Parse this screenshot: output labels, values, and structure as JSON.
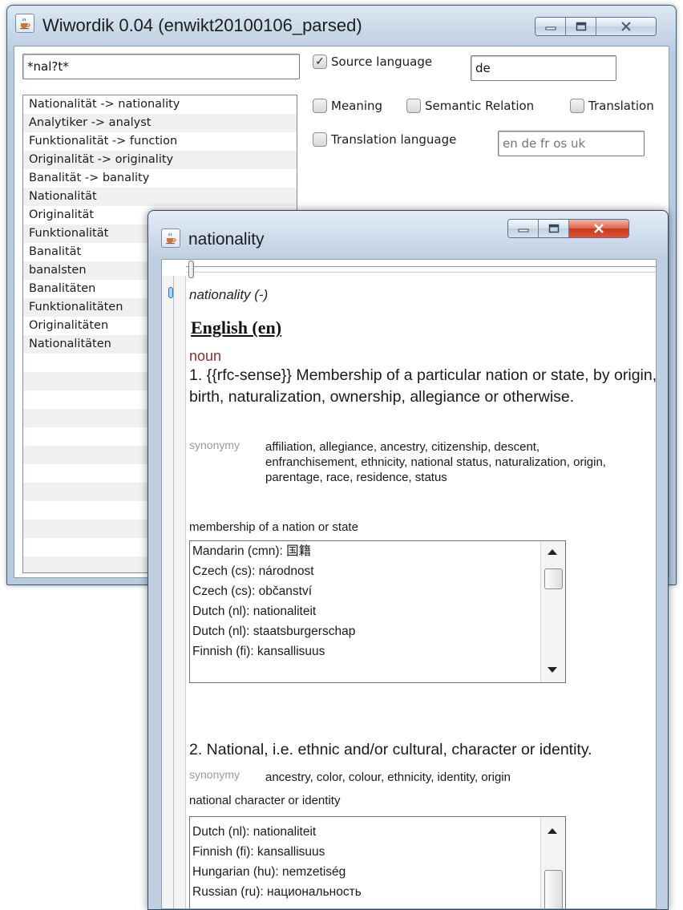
{
  "main_window": {
    "title": "Wiwordik 0.04 (enwikt20100106_parsed)",
    "search": {
      "value": "*nal?t*"
    },
    "source_language": {
      "label": "Source language",
      "checked": true,
      "value": "de"
    },
    "filters": {
      "meaning": "Meaning",
      "semantic_relation": "Semantic Relation",
      "translation": "Translation"
    },
    "translation_language": {
      "label": "Translation language",
      "placeholder": "en de fr os uk"
    },
    "results": [
      "Nationalität -> nationality",
      "Analytiker -> analyst",
      "Funktionalität -> function",
      "Originalität -> originality",
      "Banalität -> banality",
      "Nationalität",
      "Originalität",
      "Funktionalität",
      "Banalität",
      "banalsten",
      "Banalitäten",
      "Funktionalitäten",
      "Originalitäten",
      "Nationalitäten"
    ]
  },
  "popup_window": {
    "title": "nationality",
    "headword": "nationality (-)",
    "language_heading": "English (en)",
    "part_of_speech": "noun",
    "sense1": {
      "text": "1. {{rfc-sense}} Membership of a particular nation or state, by origin, birth, naturalization, ownership, allegiance or otherwise.",
      "synonymy_label": "synonymy",
      "synonyms": "affiliation, allegiance, ancestry, citizenship, descent, enfranchisement, ethnicity, national status, naturalization, origin, parentage, race, residence, status",
      "gloss": "membership of a nation or state",
      "translations": [
        "Mandarin (cmn): 国籍",
        "Czech (cs): národnost",
        "Czech (cs): občanství",
        "Dutch (nl): nationaliteit",
        "Dutch (nl): staatsburgerschap",
        "Finnish (fi): kansallisuus"
      ]
    },
    "sense2": {
      "text": "2. National, i.e. ethnic and/or cultural, character or identity.",
      "synonymy_label": "synonymy",
      "synonyms": "ancestry, color, colour, ethnicity, identity, origin",
      "gloss": "national character or identity",
      "translations": [
        "Dutch (nl): nationaliteit",
        "Finnish (fi): kansallisuus",
        "Hungarian (hu): nemzetiség",
        "Russian (ru): национальность"
      ]
    }
  }
}
